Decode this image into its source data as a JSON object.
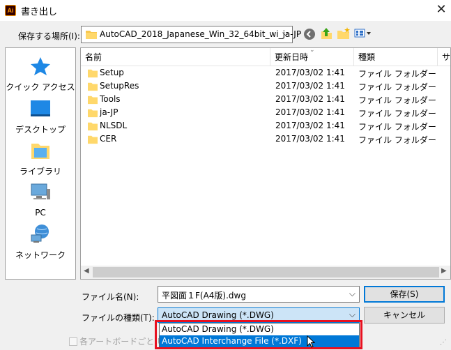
{
  "window": {
    "title": "書き出し",
    "app_icon_text": "Ai",
    "close_glyph": "✕"
  },
  "location": {
    "label": "保存する場所(I):",
    "path": "AutoCAD_2018_Japanese_Win_32_64bit_wi_ja-JP"
  },
  "places": [
    {
      "label": "クイック アクセス",
      "icon": "star-icon"
    },
    {
      "label": "デスクトップ",
      "icon": "desktop-icon"
    },
    {
      "label": "ライブラリ",
      "icon": "library-icon"
    },
    {
      "label": "PC",
      "icon": "pc-icon"
    },
    {
      "label": "ネットワーク",
      "icon": "network-icon"
    }
  ],
  "columns": {
    "name": "名前",
    "modified": "更新日時",
    "type": "種類",
    "extra": "サ"
  },
  "files": [
    {
      "name": "Setup",
      "modified": "2017/03/02 1:41",
      "type": "ファイル フォルダー"
    },
    {
      "name": "SetupRes",
      "modified": "2017/03/02 1:41",
      "type": "ファイル フォルダー"
    },
    {
      "name": "Tools",
      "modified": "2017/03/02 1:41",
      "type": "ファイル フォルダー"
    },
    {
      "name": "ja-JP",
      "modified": "2017/03/02 1:41",
      "type": "ファイル フォルダー"
    },
    {
      "name": "NLSDL",
      "modified": "2017/03/02 1:41",
      "type": "ファイル フォルダー"
    },
    {
      "name": "CER",
      "modified": "2017/03/02 1:41",
      "type": "ファイル フォルダー"
    }
  ],
  "filename": {
    "label": "ファイル名(N):",
    "value": "平図面１F(A4版).dwg"
  },
  "filetype": {
    "label": "ファイルの種類(T):",
    "value": "AutoCAD Drawing (*.DWG)",
    "options": [
      "AutoCAD Drawing (*.DWG)",
      "AutoCAD Interchange File (*.DXF)"
    ],
    "selected_index": 1
  },
  "buttons": {
    "save": "保存(S)",
    "cancel": "キャンセル"
  },
  "artboards": {
    "label": "各アートボードごと(U)"
  },
  "colors": {
    "accent": "#0078d7",
    "highlight_border": "#e8101f",
    "folder": "#ffd86b"
  }
}
